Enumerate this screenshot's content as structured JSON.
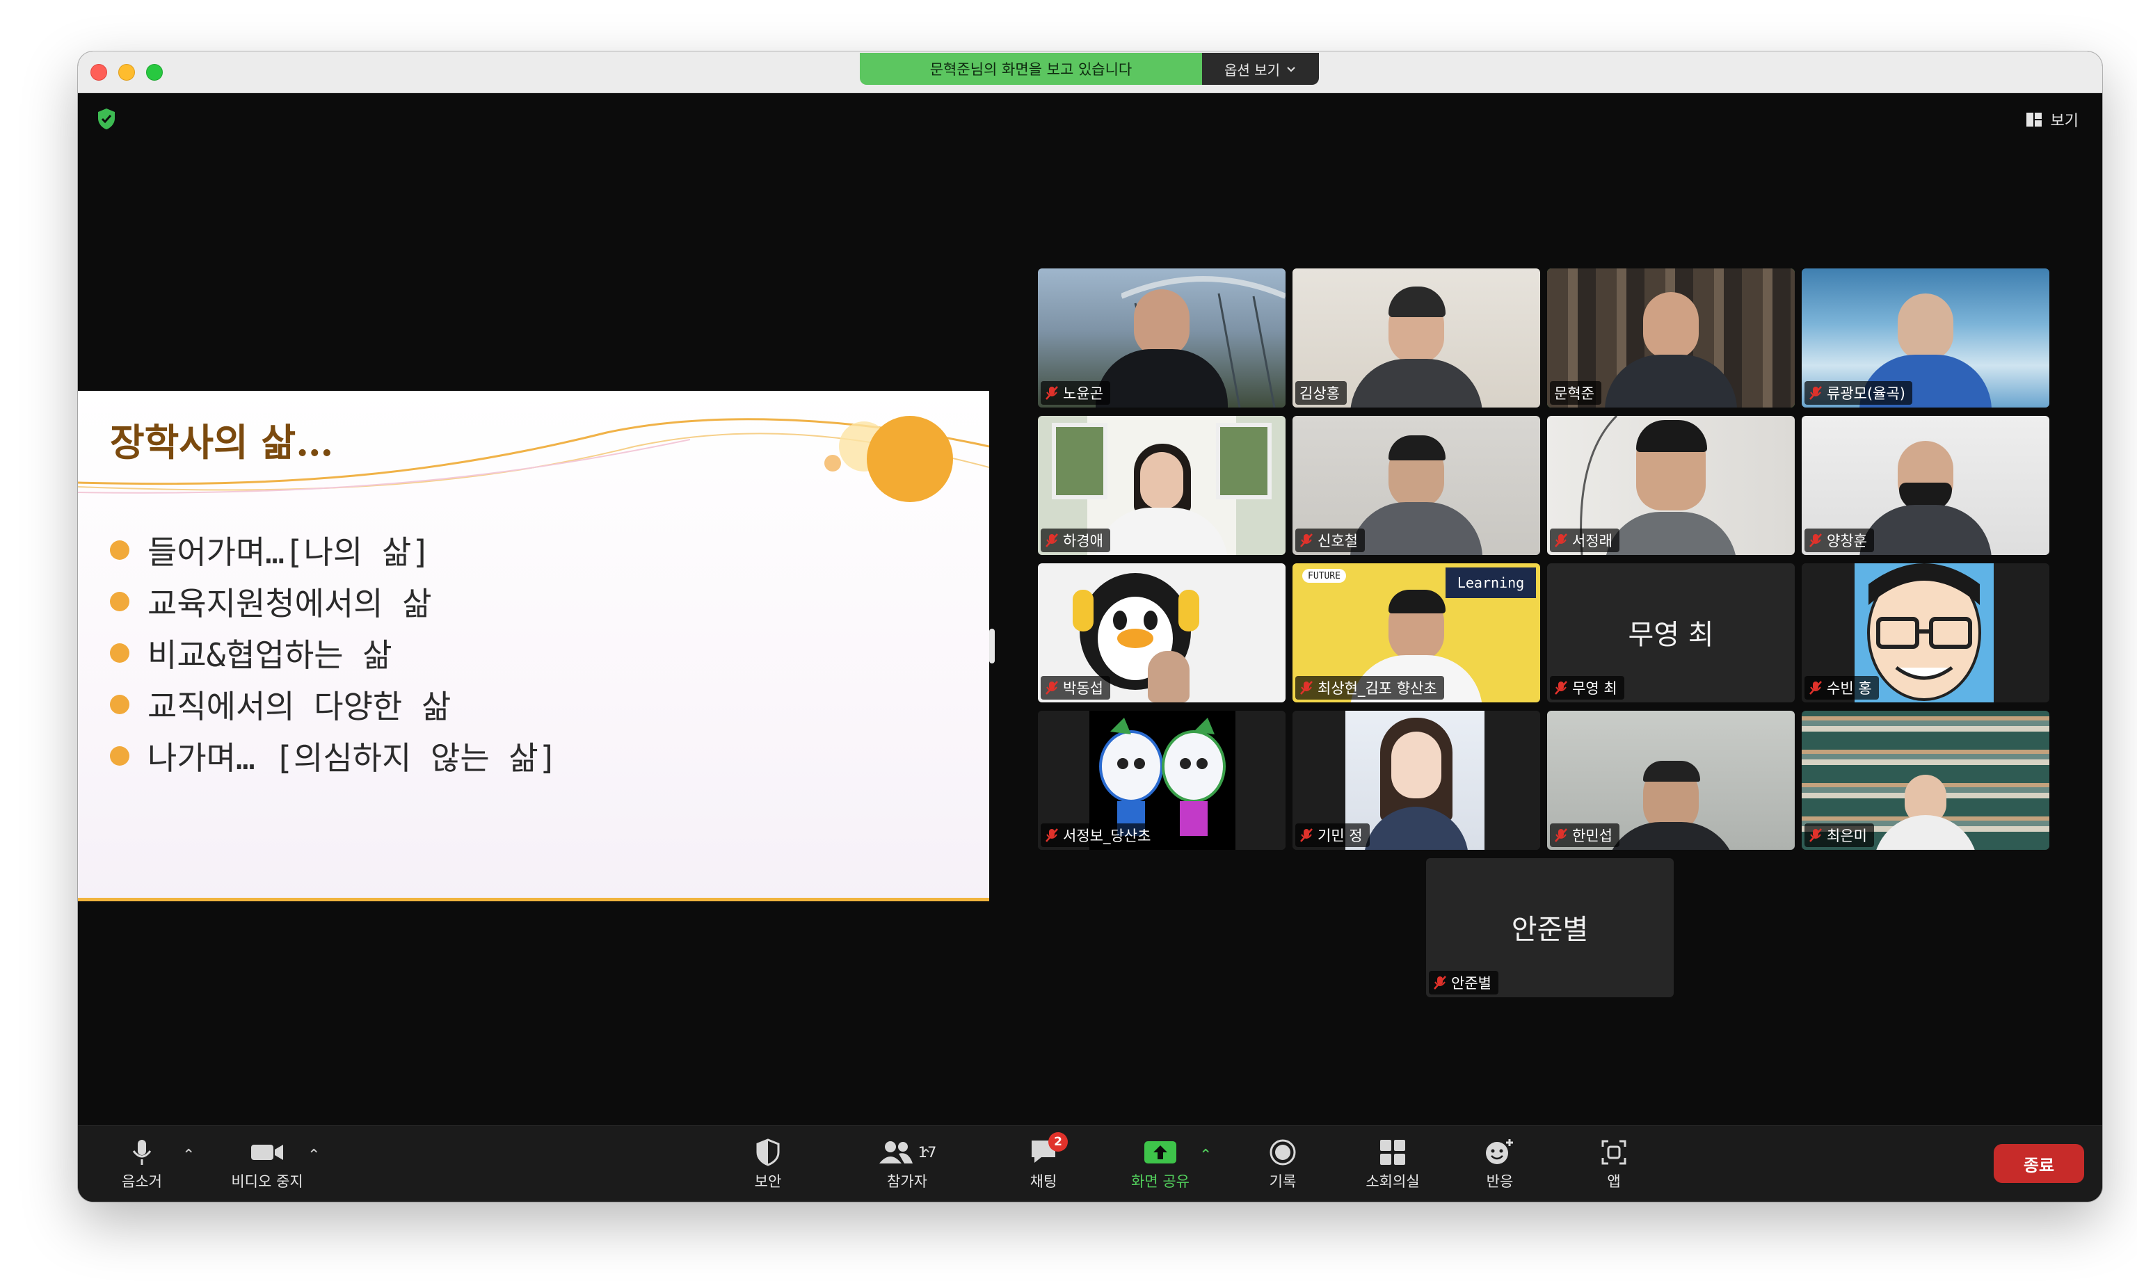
{
  "share_banner": {
    "message": "문혁준님의 화면을 보고 있습니다",
    "options": "옵션 보기"
  },
  "top_bar": {
    "view_label": "보기"
  },
  "slide": {
    "title": "장학사의 삶…",
    "bullets": [
      "들어가며…[나의 삶]",
      "교육지원청에서의 삶",
      "비교&협업하는 삶",
      "교직에서의 다양한 삶",
      "나가며… [의심하지 않는 삶]"
    ]
  },
  "participants": [
    {
      "name": "노윤곤",
      "muted": true
    },
    {
      "name": "김상홍",
      "muted": false
    },
    {
      "name": "문혁준",
      "muted": false,
      "active": true
    },
    {
      "name": "류광모(율곡)",
      "muted": true
    },
    {
      "name": "하경애",
      "muted": true
    },
    {
      "name": "신호철",
      "muted": true
    },
    {
      "name": "서정래",
      "muted": true
    },
    {
      "name": "양창훈",
      "muted": true
    },
    {
      "name": "박동섭",
      "muted": true
    },
    {
      "name": "최상현_김포 향산초",
      "muted": true
    },
    {
      "name": "무영 최",
      "muted": true,
      "video_off": true,
      "display_name": "무영 최"
    },
    {
      "name": "수빈 홍",
      "muted": true
    },
    {
      "name": "서정보_당산초",
      "muted": true
    },
    {
      "name": "기민 정",
      "muted": true
    },
    {
      "name": "한민섭",
      "muted": true
    },
    {
      "name": "최은미",
      "muted": true
    },
    {
      "name": "안준별",
      "muted": true,
      "video_off": true,
      "display_name": "안준별"
    }
  ],
  "tile_overlays": {
    "future_label": "FUTURE",
    "learning_label": "Learning"
  },
  "toolbar": {
    "mute": "음소거",
    "stop_video": "비디오 중지",
    "security": "보안",
    "participants": "참가자",
    "participants_count": "17",
    "chat": "채팅",
    "chat_badge": "2",
    "share_screen": "화면 공유",
    "record": "기록",
    "breakout": "소회의실",
    "reactions": "반응",
    "apps": "앱",
    "end": "종료"
  },
  "colors": {
    "share_green": "#5cc660",
    "active_speaker": "#3fd24c",
    "end_red": "#c72b29",
    "slide_accent": "#f1a93a"
  }
}
